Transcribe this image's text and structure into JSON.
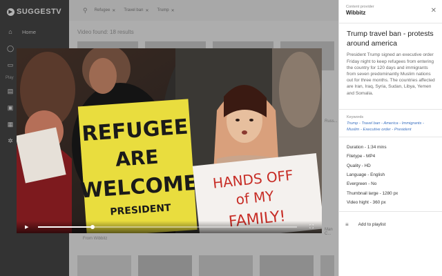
{
  "app": {
    "name": "SUGGESTV"
  },
  "sidebar": {
    "items": [
      {
        "label": "Home",
        "icon": "home-icon"
      },
      {
        "label": "",
        "icon": "explore-icon"
      },
      {
        "label": "",
        "icon": "tv-icon"
      },
      {
        "label": "",
        "icon": "playlist-icon"
      },
      {
        "label": "",
        "icon": "inbox-icon"
      },
      {
        "label": "",
        "icon": "lock-icon"
      },
      {
        "label": "",
        "icon": "settings-icon"
      }
    ],
    "section_label": "Play"
  },
  "search": {
    "chips": [
      "Refugee",
      "Travel ban",
      "Trump"
    ]
  },
  "main": {
    "found_text": "Video found: 18 results",
    "captions": [
      "From Wibbitz",
      "Russ...",
      "Man C..."
    ]
  },
  "player": {
    "progress": 0.21
  },
  "panel": {
    "provider_label": "Content provider",
    "provider": "Wibbitz",
    "title": "Trump travel ban - protests around america",
    "description": "President Trump signed an executive order Friday night to keep refugees from entering the country for 120 days and immigrants from seven predominantly Muslim nations out for three months. The countries affected are Iran, Iraq, Syria, Sudan, Libya, Yemen and Somalia.",
    "keywords_label": "Keywords",
    "keywords": "Trump - Travel ban - America - Immigrants - Muslim - Executive order - President",
    "meta": [
      "Duration - 1:34 mins",
      "Filetype - MP4",
      "Quality - HD",
      "Language - English",
      "Evergreen - No",
      "Thumbnail large - 1280 px",
      "Video hight - 360 px"
    ],
    "add_label": "Add to playlist"
  },
  "sign_text": {
    "left_1": "REFUGEE",
    "left_2": "ARE",
    "left_3": "WELCOME",
    "left_4": "PRESIDENT",
    "right_1": "HANDS OFF",
    "right_2": "of MY",
    "right_3": "FAMILY!"
  }
}
